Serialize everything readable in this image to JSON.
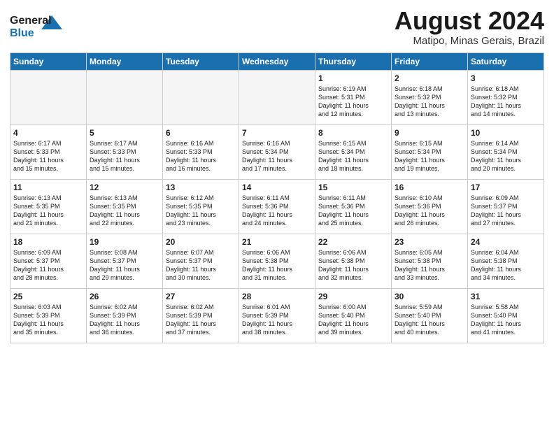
{
  "header": {
    "logo_general": "General",
    "logo_blue": "Blue",
    "month_title": "August 2024",
    "location": "Matipo, Minas Gerais, Brazil"
  },
  "weekdays": [
    "Sunday",
    "Monday",
    "Tuesday",
    "Wednesday",
    "Thursday",
    "Friday",
    "Saturday"
  ],
  "weeks": [
    [
      {
        "day": "",
        "info": ""
      },
      {
        "day": "",
        "info": ""
      },
      {
        "day": "",
        "info": ""
      },
      {
        "day": "",
        "info": ""
      },
      {
        "day": "1",
        "info": "Sunrise: 6:19 AM\nSunset: 5:31 PM\nDaylight: 11 hours\nand 12 minutes."
      },
      {
        "day": "2",
        "info": "Sunrise: 6:18 AM\nSunset: 5:32 PM\nDaylight: 11 hours\nand 13 minutes."
      },
      {
        "day": "3",
        "info": "Sunrise: 6:18 AM\nSunset: 5:32 PM\nDaylight: 11 hours\nand 14 minutes."
      }
    ],
    [
      {
        "day": "4",
        "info": "Sunrise: 6:17 AM\nSunset: 5:33 PM\nDaylight: 11 hours\nand 15 minutes."
      },
      {
        "day": "5",
        "info": "Sunrise: 6:17 AM\nSunset: 5:33 PM\nDaylight: 11 hours\nand 15 minutes."
      },
      {
        "day": "6",
        "info": "Sunrise: 6:16 AM\nSunset: 5:33 PM\nDaylight: 11 hours\nand 16 minutes."
      },
      {
        "day": "7",
        "info": "Sunrise: 6:16 AM\nSunset: 5:34 PM\nDaylight: 11 hours\nand 17 minutes."
      },
      {
        "day": "8",
        "info": "Sunrise: 6:15 AM\nSunset: 5:34 PM\nDaylight: 11 hours\nand 18 minutes."
      },
      {
        "day": "9",
        "info": "Sunrise: 6:15 AM\nSunset: 5:34 PM\nDaylight: 11 hours\nand 19 minutes."
      },
      {
        "day": "10",
        "info": "Sunrise: 6:14 AM\nSunset: 5:34 PM\nDaylight: 11 hours\nand 20 minutes."
      }
    ],
    [
      {
        "day": "11",
        "info": "Sunrise: 6:13 AM\nSunset: 5:35 PM\nDaylight: 11 hours\nand 21 minutes."
      },
      {
        "day": "12",
        "info": "Sunrise: 6:13 AM\nSunset: 5:35 PM\nDaylight: 11 hours\nand 22 minutes."
      },
      {
        "day": "13",
        "info": "Sunrise: 6:12 AM\nSunset: 5:35 PM\nDaylight: 11 hours\nand 23 minutes."
      },
      {
        "day": "14",
        "info": "Sunrise: 6:11 AM\nSunset: 5:36 PM\nDaylight: 11 hours\nand 24 minutes."
      },
      {
        "day": "15",
        "info": "Sunrise: 6:11 AM\nSunset: 5:36 PM\nDaylight: 11 hours\nand 25 minutes."
      },
      {
        "day": "16",
        "info": "Sunrise: 6:10 AM\nSunset: 5:36 PM\nDaylight: 11 hours\nand 26 minutes."
      },
      {
        "day": "17",
        "info": "Sunrise: 6:09 AM\nSunset: 5:37 PM\nDaylight: 11 hours\nand 27 minutes."
      }
    ],
    [
      {
        "day": "18",
        "info": "Sunrise: 6:09 AM\nSunset: 5:37 PM\nDaylight: 11 hours\nand 28 minutes."
      },
      {
        "day": "19",
        "info": "Sunrise: 6:08 AM\nSunset: 5:37 PM\nDaylight: 11 hours\nand 29 minutes."
      },
      {
        "day": "20",
        "info": "Sunrise: 6:07 AM\nSunset: 5:37 PM\nDaylight: 11 hours\nand 30 minutes."
      },
      {
        "day": "21",
        "info": "Sunrise: 6:06 AM\nSunset: 5:38 PM\nDaylight: 11 hours\nand 31 minutes."
      },
      {
        "day": "22",
        "info": "Sunrise: 6:06 AM\nSunset: 5:38 PM\nDaylight: 11 hours\nand 32 minutes."
      },
      {
        "day": "23",
        "info": "Sunrise: 6:05 AM\nSunset: 5:38 PM\nDaylight: 11 hours\nand 33 minutes."
      },
      {
        "day": "24",
        "info": "Sunrise: 6:04 AM\nSunset: 5:38 PM\nDaylight: 11 hours\nand 34 minutes."
      }
    ],
    [
      {
        "day": "25",
        "info": "Sunrise: 6:03 AM\nSunset: 5:39 PM\nDaylight: 11 hours\nand 35 minutes."
      },
      {
        "day": "26",
        "info": "Sunrise: 6:02 AM\nSunset: 5:39 PM\nDaylight: 11 hours\nand 36 minutes."
      },
      {
        "day": "27",
        "info": "Sunrise: 6:02 AM\nSunset: 5:39 PM\nDaylight: 11 hours\nand 37 minutes."
      },
      {
        "day": "28",
        "info": "Sunrise: 6:01 AM\nSunset: 5:39 PM\nDaylight: 11 hours\nand 38 minutes."
      },
      {
        "day": "29",
        "info": "Sunrise: 6:00 AM\nSunset: 5:40 PM\nDaylight: 11 hours\nand 39 minutes."
      },
      {
        "day": "30",
        "info": "Sunrise: 5:59 AM\nSunset: 5:40 PM\nDaylight: 11 hours\nand 40 minutes."
      },
      {
        "day": "31",
        "info": "Sunrise: 5:58 AM\nSunset: 5:40 PM\nDaylight: 11 hours\nand 41 minutes."
      }
    ]
  ]
}
